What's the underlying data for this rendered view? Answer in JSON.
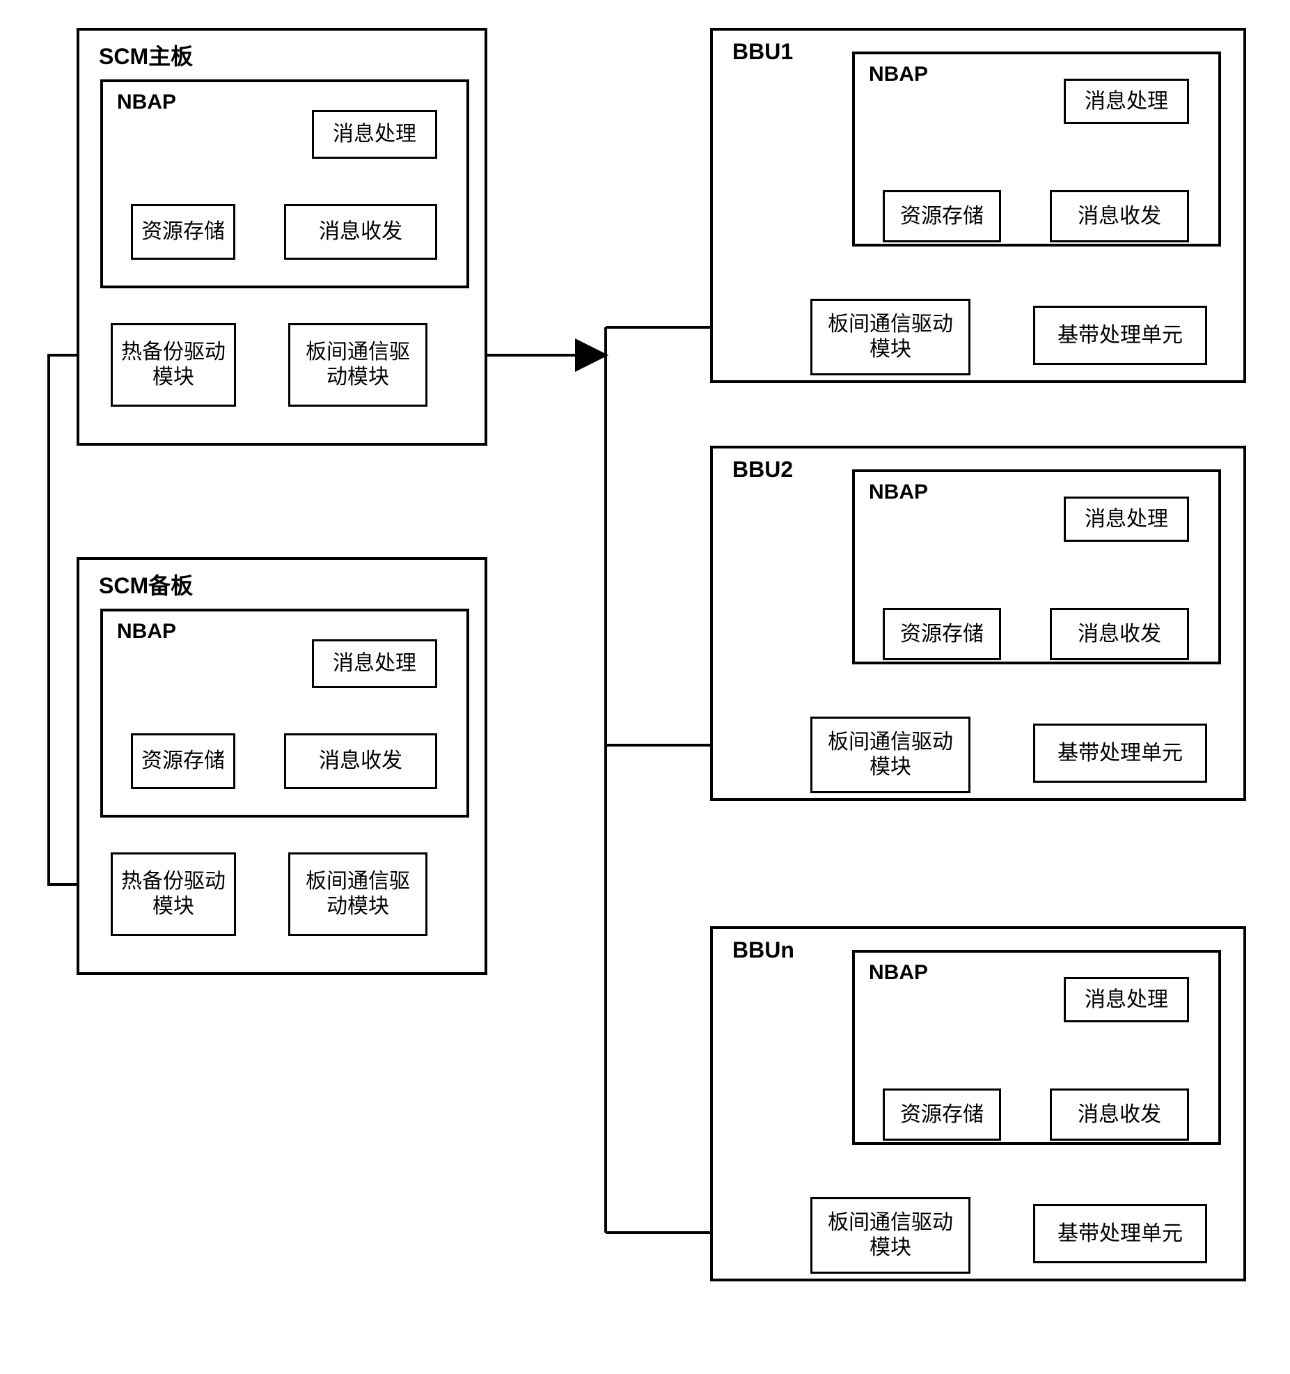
{
  "scm_main": {
    "title": "SCM主板",
    "nbap": {
      "title": "NBAP",
      "msg_proc": "消息处理",
      "res_store": "资源存储",
      "msg_trx": "消息收发"
    },
    "hot_backup": "热备份驱动模块",
    "inter_comm": "板间通信驱动模块"
  },
  "scm_backup": {
    "title": "SCM备板",
    "nbap": {
      "title": "NBAP",
      "msg_proc": "消息处理",
      "res_store": "资源存储",
      "msg_trx": "消息收发"
    },
    "hot_backup": "热备份驱动模块",
    "inter_comm": "板间通信驱动模块"
  },
  "bbu1": {
    "title": "BBU1",
    "nbap": {
      "title": "NBAP",
      "msg_proc": "消息处理",
      "res_store": "资源存储",
      "msg_trx": "消息收发"
    },
    "inter_comm": "板间通信驱动模块",
    "baseband": "基带处理单元"
  },
  "bbu2": {
    "title": "BBU2",
    "nbap": {
      "title": "NBAP",
      "msg_proc": "消息处理",
      "res_store": "资源存储",
      "msg_trx": "消息收发"
    },
    "inter_comm": "板间通信驱动模块",
    "baseband": "基带处理单元"
  },
  "bbun": {
    "title": "BBUn",
    "nbap": {
      "title": "NBAP",
      "msg_proc": "消息处理",
      "res_store": "资源存储",
      "msg_trx": "消息收发"
    },
    "inter_comm": "板间通信驱动模块",
    "baseband": "基带处理单元"
  }
}
